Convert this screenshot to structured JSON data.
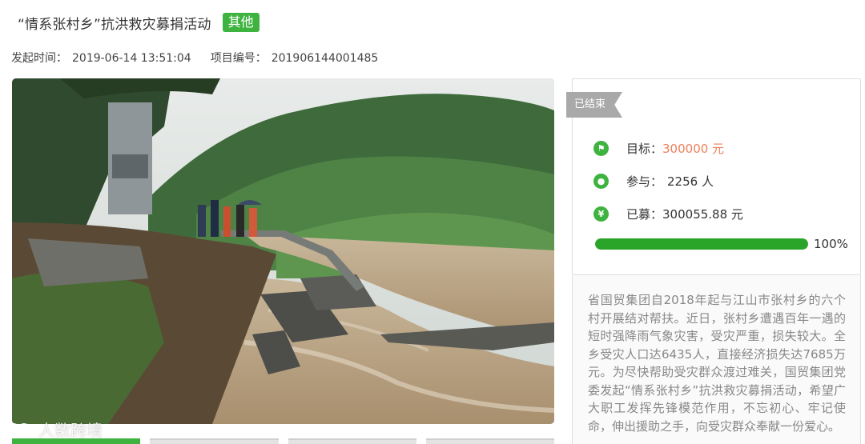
{
  "header": {
    "title": "“情系张村乡”抗洪救灾募捐活动",
    "tag": "其他"
  },
  "meta": {
    "start_label": "发起时间：",
    "start_value": "2019-06-14 13:51:04",
    "project_label": "项目编号：",
    "project_value": "201906144001485"
  },
  "status": {
    "ribbon": "已结束"
  },
  "stats": {
    "goal_label": "目标：",
    "goal_value": "300000 元",
    "participants_label": "参与：",
    "participants_value": "2256 人",
    "raised_label": "已募：",
    "raised_value": "300055.88 元",
    "progress_percent": 100,
    "progress_text": "100%"
  },
  "description": "省国贸集团自2018年起与江山市张村乡的六个村开展结对帮扶。近日，张村乡遭遇百年一遇的短时强降雨气象灾害，受灾严重，损失较大。全乡受灾人口达6435人，直接经济损失达7685万元。为尽快帮助受灾群众渡过难关，国贸集团党委发起“情系张村乡”抗洪救灾募捐活动，希望广大职工发挥先锋模范作用，不忘初心、牢记使命，伸出援助之手，向受灾群众奉献一份爱心。",
  "watermark": "人数跨境",
  "colors": {
    "brand_green": "#3fb33f",
    "accent_orange": "#ef7f59",
    "ribbon_gray": "#a9a9a9"
  },
  "icons": {
    "goal": "flag-icon",
    "participants": "person-icon",
    "raised": "yen-icon"
  }
}
